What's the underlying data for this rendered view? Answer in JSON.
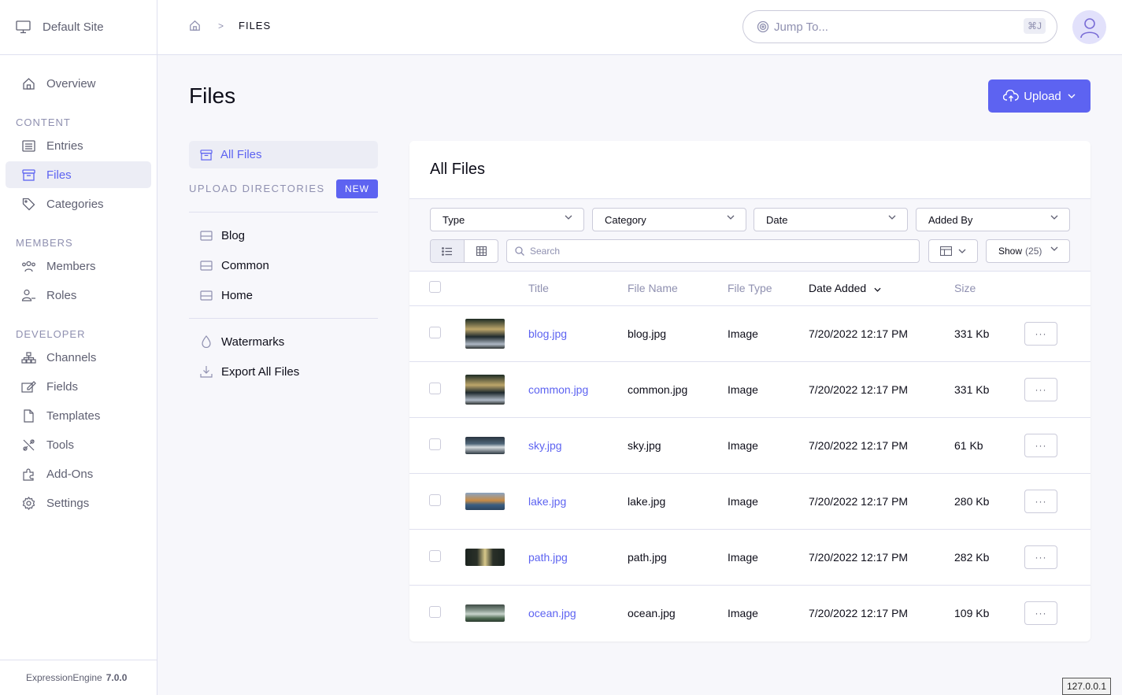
{
  "site": {
    "name": "Default Site"
  },
  "nav": {
    "overview": "Overview",
    "content_label": "CONTENT",
    "entries": "Entries",
    "files": "Files",
    "categories": "Categories",
    "members_label": "MEMBERS",
    "members": "Members",
    "roles": "Roles",
    "developer_label": "DEVELOPER",
    "channels": "Channels",
    "fields": "Fields",
    "templates": "Templates",
    "tools": "Tools",
    "addons": "Add-Ons",
    "settings": "Settings"
  },
  "footer": {
    "product": "ExpressionEngine",
    "version": "7.0.0"
  },
  "breadcrumb": {
    "current": "FILES",
    "separator": ">"
  },
  "jump": {
    "placeholder": "Jump To...",
    "shortcut": "⌘J"
  },
  "page": {
    "title": "Files",
    "upload_label": "Upload"
  },
  "sub": {
    "all_files": "All Files",
    "upload_dirs_label": "UPLOAD DIRECTORIES",
    "new_label": "NEW",
    "directories": [
      "Blog",
      "Common",
      "Home"
    ],
    "watermarks": "Watermarks",
    "export": "Export All Files"
  },
  "panel": {
    "title": "All Files",
    "filters": {
      "type": "Type",
      "category": "Category",
      "date": "Date",
      "added_by": "Added By"
    },
    "search_placeholder": "Search",
    "show_label": "Show",
    "show_count": "(25)"
  },
  "table": {
    "headers": {
      "title": "Title",
      "file_name": "File Name",
      "file_type": "File Type",
      "date_added": "Date Added",
      "size": "Size"
    },
    "rows": [
      {
        "title": "blog.jpg",
        "file_name": "blog.jpg",
        "file_type": "Image",
        "date": "7/20/2022 12:17 PM",
        "size": "331 Kb"
      },
      {
        "title": "common.jpg",
        "file_name": "common.jpg",
        "file_type": "Image",
        "date": "7/20/2022 12:17 PM",
        "size": "331 Kb"
      },
      {
        "title": "sky.jpg",
        "file_name": "sky.jpg",
        "file_type": "Image",
        "date": "7/20/2022 12:17 PM",
        "size": "61 Kb"
      },
      {
        "title": "lake.jpg",
        "file_name": "lake.jpg",
        "file_type": "Image",
        "date": "7/20/2022 12:17 PM",
        "size": "280 Kb"
      },
      {
        "title": "path.jpg",
        "file_name": "path.jpg",
        "file_type": "Image",
        "date": "7/20/2022 12:17 PM",
        "size": "282 Kb"
      },
      {
        "title": "ocean.jpg",
        "file_name": "ocean.jpg",
        "file_type": "Image",
        "date": "7/20/2022 12:17 PM",
        "size": "109 Kb"
      }
    ],
    "more_label": "···"
  },
  "ip": "127.0.0.1",
  "colors": {
    "accent": "#5d63f1",
    "muted": "#8f90b0",
    "border": "#dfe0ef"
  }
}
